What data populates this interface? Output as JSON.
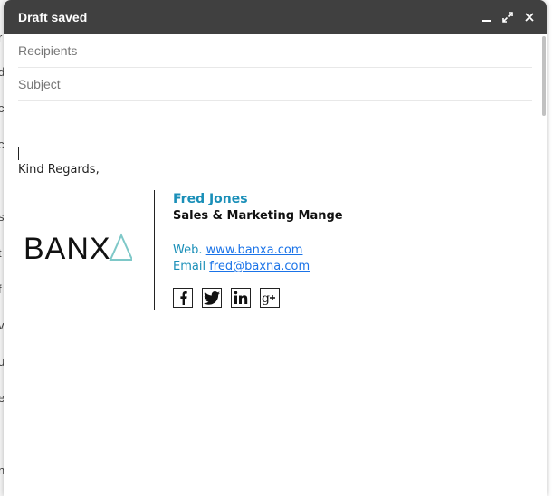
{
  "window": {
    "title": "Draft saved"
  },
  "titlebar_icons": [
    "minimize-icon",
    "expand-icon",
    "close-icon"
  ],
  "fields": {
    "recipients_placeholder": "Recipients",
    "subject_placeholder": "Subject"
  },
  "body": {
    "greeting": "Kind Regards,"
  },
  "signature": {
    "logo_text": "BANXA",
    "name": "Fred Jones",
    "role": "Sales & Marketing Mange",
    "web_label": "Web.",
    "web_url": "www.banxa.com",
    "email_label": "Email",
    "email": "fred@baxna.com",
    "socials": [
      "facebook-icon",
      "twitter-icon",
      "linkedin-icon",
      "google-plus-icon"
    ]
  },
  "colors": {
    "titlebar": "#404040",
    "accent": "#1a8fb8",
    "link": "#1a73e8"
  }
}
